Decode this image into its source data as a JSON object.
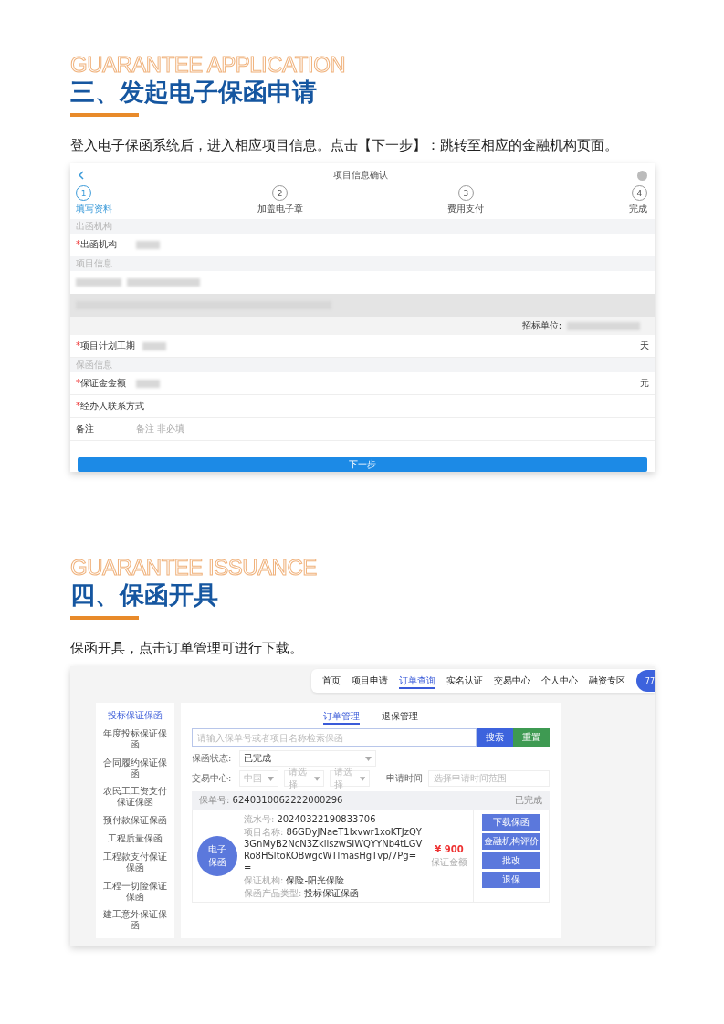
{
  "section_1": {
    "bg_title": "GUARANTEE APPLICATION",
    "title": "三、发起电子保函申请",
    "intro": "登入电子保函系统后，进入相应项目信息。点击【下一步】：跳转至相应的金融机构页面。",
    "app": {
      "title": "项目信息确认",
      "steps": [
        {
          "number": "1",
          "label": "填写资料",
          "selected": true
        },
        {
          "number": "2",
          "label": "加盖电子章",
          "selected": false
        },
        {
          "number": "3",
          "label": "费用支付",
          "selected": false
        },
        {
          "number": "4",
          "label": "完成",
          "selected": false
        }
      ],
      "rows": [
        {
          "kind": "group",
          "label": "出函机构"
        },
        {
          "kind": "field",
          "required_mark": "*",
          "label": "出函机构",
          "value_hidden": true
        },
        {
          "kind": "group",
          "label": "项目信息"
        },
        {
          "kind": "blurred",
          "shaded": false
        },
        {
          "kind": "blurred",
          "shaded": true
        },
        {
          "kind": "info",
          "label": "招标单位:"
        },
        {
          "kind": "field",
          "required_mark": "*",
          "label": "项目计划工期",
          "value_hidden": true,
          "unit": "天"
        },
        {
          "kind": "group",
          "label": "保函信息"
        },
        {
          "kind": "field",
          "required_mark": "*",
          "label": "保证金金额",
          "value_hidden": true,
          "unit": "元"
        },
        {
          "kind": "field",
          "required_mark": "*",
          "label": "经办人联系方式",
          "value_hidden": false
        },
        {
          "kind": "field",
          "label": "备注",
          "value_hidden": false,
          "placeholder": "备注 非必填"
        }
      ],
      "button": "下一步"
    }
  },
  "section_2": {
    "bg_title": "GUARANTEE ISSUANCE",
    "title": "四、保函开具",
    "intro": "保函开具，点击订单管理可进行下载。",
    "app": {
      "nav": [
        {
          "label": "首页",
          "selected": false
        },
        {
          "label": "项目申请",
          "selected": false
        },
        {
          "label": "订单查询",
          "selected": true
        },
        {
          "label": "实名认证",
          "selected": false
        },
        {
          "label": "交易中心",
          "selected": false
        },
        {
          "label": "个人中心",
          "selected": false
        },
        {
          "label": "融资专区",
          "selected": false
        }
      ],
      "avatar": "77",
      "sidebar": [
        {
          "label": "投标保证保函",
          "selected": true
        },
        {
          "label": "年度投标保证保函",
          "selected": false
        },
        {
          "label": "合同履约保证保函",
          "selected": false
        },
        {
          "label": "农民工工资支付保证保函",
          "selected": false
        },
        {
          "label": "预付款保证保函",
          "selected": false
        },
        {
          "label": "工程质量保函",
          "selected": false
        },
        {
          "label": "工程款支付保证保函",
          "selected": false
        },
        {
          "label": "工程一切险保证保函",
          "selected": false
        },
        {
          "label": "建工意外保证保函",
          "selected": false
        }
      ],
      "tabs": [
        {
          "label": "订单管理",
          "selected": true
        },
        {
          "label": "退保管理",
          "selected": false
        }
      ],
      "search": {
        "placeholder": "请输入保单号或者项目名称检索保函",
        "search_button": "搜索",
        "reset_button": "重置"
      },
      "status_filter": {
        "label": "保函状态:",
        "value": "已完成"
      },
      "center_filter": {
        "label": "交易中心:",
        "selects": [
          "中国",
          "请选择",
          "请选择"
        ]
      },
      "date_filter": {
        "label": "申请时间",
        "placeholder": "选择申请时间范围"
      },
      "order": {
        "number_label": "保单号:",
        "number": "6240310062222000296",
        "status": "已完成",
        "badge": [
          "电子",
          "保函"
        ],
        "details": [
          {
            "label": "流水号:",
            "value": "20240322190833706"
          },
          {
            "label": "项目名称:",
            "value": "86GDyJNaeT1Ixvwr1xoKTJzQY3GnMyB2NcN3ZkllszwSIWQYYNb4tLGVRo8HSltoKOBwgcWTlmasHgTvp/7Pg=="
          },
          {
            "label": "保证机构:",
            "value": "保险-阳光保险"
          },
          {
            "label": "保函产品类型:",
            "value": "投标保证保函"
          }
        ],
        "price": "¥ 900",
        "price_label": "保证金额",
        "actions": [
          "下载保函",
          "金融机构评价",
          "批改",
          "退保"
        ]
      }
    }
  }
}
